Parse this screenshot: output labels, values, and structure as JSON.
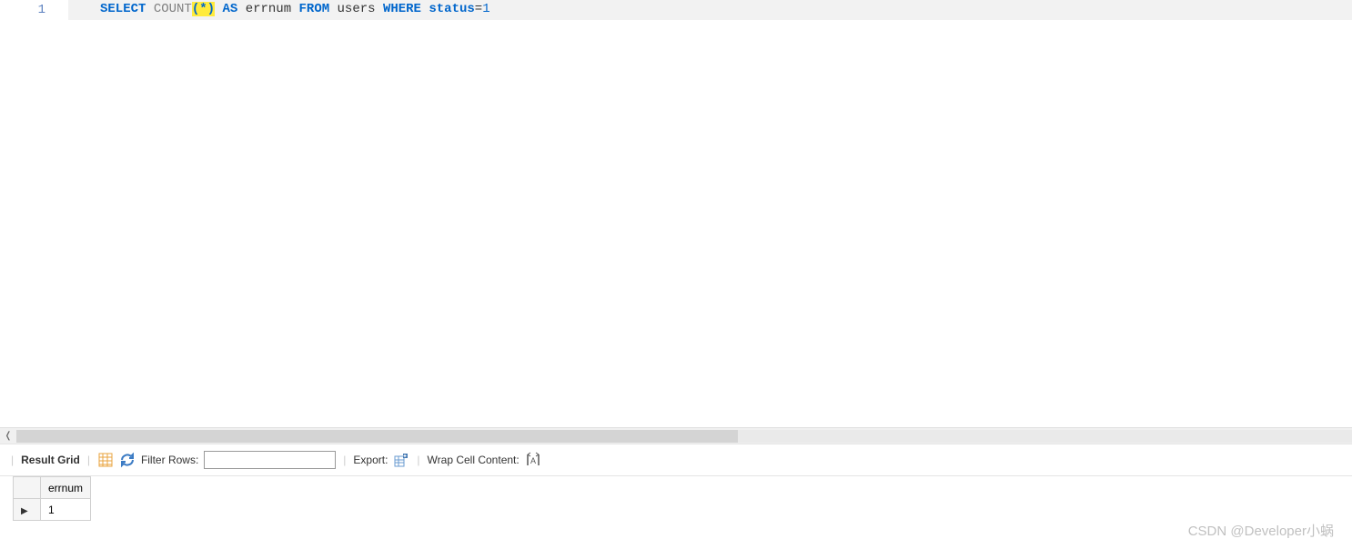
{
  "editor": {
    "line_number": "1",
    "tokens": {
      "select": "SELECT",
      "count": "COUNT",
      "lp": "(",
      "star": "*",
      "rp": ")",
      "as": "AS",
      "alias": "errnum",
      "from": "FROM",
      "table": "users",
      "where": "WHERE",
      "col": "status",
      "eq": "=",
      "val": "1"
    }
  },
  "toolbar": {
    "result_grid": "Result Grid",
    "filter_label": "Filter Rows:",
    "filter_value": "",
    "export_label": "Export:",
    "wrap_label": "Wrap Cell Content:"
  },
  "results": {
    "columns": [
      "errnum"
    ],
    "rows": [
      {
        "marker": "▶",
        "cells": [
          "1"
        ]
      }
    ]
  },
  "watermark": "CSDN @Developer小蜗"
}
